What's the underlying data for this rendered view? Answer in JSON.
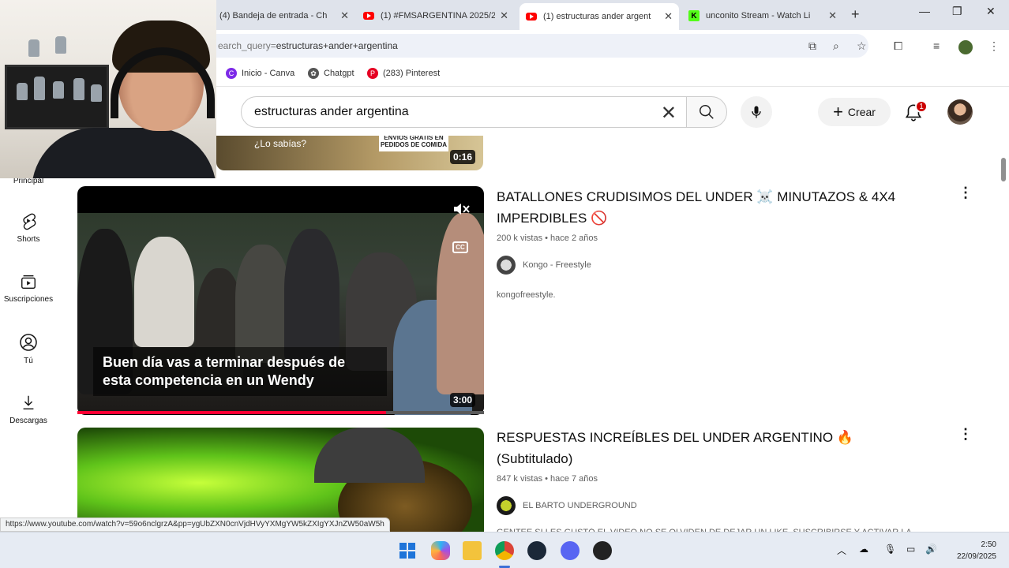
{
  "browser": {
    "tabs": [
      {
        "label": "(4) Bandeja de entrada - Ch",
        "favicon": "mail-icon"
      },
      {
        "label": "(1) #FMSARGENTINA 2025/2",
        "favicon": "youtube-icon"
      },
      {
        "label": "(1) estructuras ander argent",
        "favicon": "youtube-icon",
        "active": true
      },
      {
        "label": "unconito Stream - Watch Li",
        "favicon": "kick-icon"
      }
    ],
    "address": {
      "prefix": "earch_query=",
      "query": "estructuras+ander+argentina"
    },
    "bookmarks": [
      {
        "label": "Inicio - Canva",
        "icon": "canva-icon",
        "color": "#7d2ae8"
      },
      {
        "label": "Chatgpt",
        "icon": "chatgpt-icon",
        "color": "#555555"
      },
      {
        "label": "(283) Pinterest",
        "icon": "pinterest-icon",
        "color": "#e60023"
      }
    ]
  },
  "youtube": {
    "search_value": "estructuras ander argentina",
    "create_label": "Crear",
    "notifications": "1"
  },
  "sidebar": {
    "items": [
      {
        "label": "Principal",
        "icon": "home-icon"
      },
      {
        "label": "Shorts",
        "icon": "shorts-icon"
      },
      {
        "label": "Suscripciones",
        "icon": "subscriptions-icon"
      },
      {
        "label": "Tú",
        "icon": "user-icon"
      },
      {
        "label": "Descargas",
        "icon": "download-icon"
      }
    ]
  },
  "results": {
    "top_partial": {
      "thumb_text": "¿Lo sabías?",
      "badge_text": "ENVIOS GRATIS EN PEDIDOS DE COMIDA",
      "duration": "0:16"
    },
    "videos": [
      {
        "title": "BATALLONES CRUDISIMOS DEL UNDER ☠️ MINUTAZOS & 4X4 IMPERDIBLES 🚫",
        "stats": "200 k vistas • hace 2 años",
        "channel": "Kongo - Freestyle",
        "description": "kongofreestyle.",
        "caption": "Buen día vas a terminar después de esta competencia en un Wendy",
        "duration": "3:00",
        "progress": 0.76
      },
      {
        "title": "RESPUESTAS INCREÍBLES DEL UNDER ARGENTINO 🔥 (Subtitulado)",
        "stats": "847 k vistas • hace 7 años",
        "channel": "EL BARTO UNDERGROUND",
        "description": "GENTEE SI LES GUSTÓ EL VIDEO NO SE OLVIDEN DE DEJAR UN LIKE, SUSCRIBIRSE Y ACTIVAR LA"
      }
    ]
  },
  "status_url": "https://www.youtube.com/watch?v=59o6nclgrzA&pp=ygUbZXN0cnVjdHVyYXMgYW5kZXIgYXJnZW50aW5h",
  "taskbar": {
    "time": "2:50",
    "date": "22/09/2025"
  },
  "colors": {
    "accent": "#ff0033",
    "notification": "#cc0000"
  }
}
